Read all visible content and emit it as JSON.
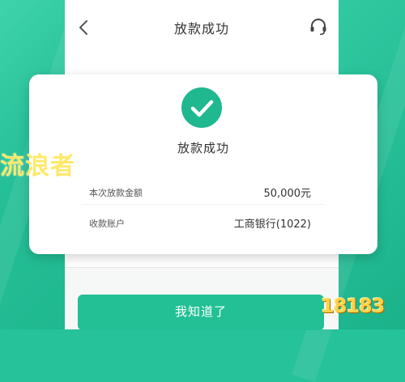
{
  "header": {
    "title": "放款成功",
    "back_icon": "chevron-left-icon",
    "support_icon": "headset-icon"
  },
  "card": {
    "status_icon": "check-circle-icon",
    "status_text": "放款成功",
    "rows": [
      {
        "label": "本次放款金额",
        "value": "50,000元"
      },
      {
        "label": "收款账户",
        "value": "工商银行(1022)"
      }
    ]
  },
  "footer": {
    "confirm_label": "我知道了"
  },
  "watermarks": {
    "left": "流浪者",
    "right": "18183"
  },
  "colors": {
    "accent": "#22c094",
    "background": "#26c29a",
    "text": "#333333"
  }
}
